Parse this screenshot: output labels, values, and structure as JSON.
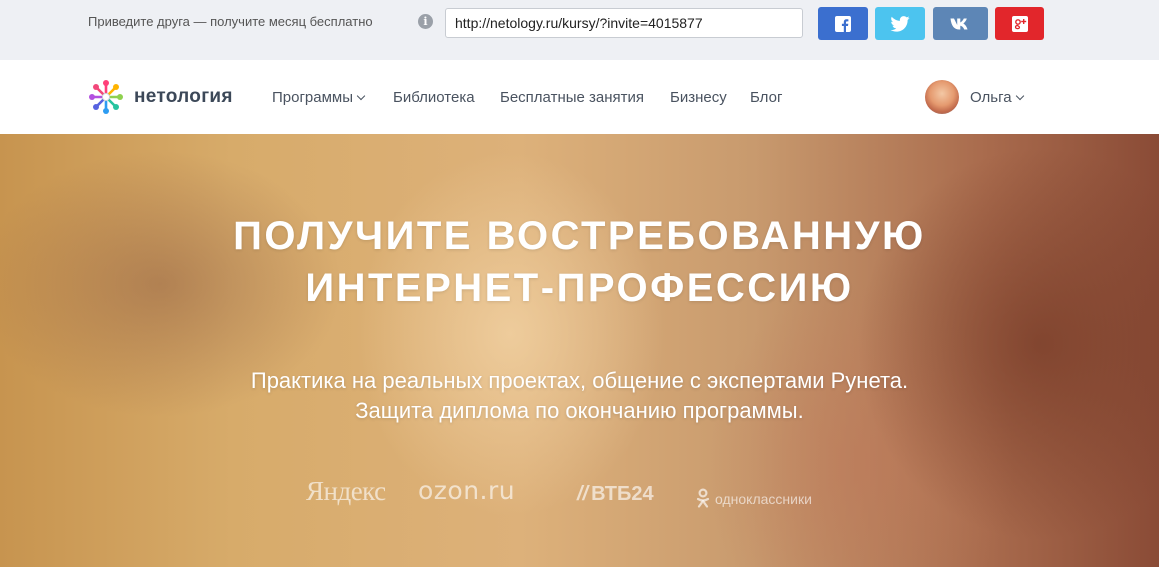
{
  "referral": {
    "text": "Приведите друга — получите месяц бесплатно",
    "info_icon": "info-icon",
    "invite_url": "http://netology.ru/kursy/?invite=4015877",
    "share_buttons": [
      {
        "name": "facebook",
        "icon": "facebook-icon",
        "color": "#3b6fcf"
      },
      {
        "name": "twitter",
        "icon": "twitter-icon",
        "color": "#4cc4ef"
      },
      {
        "name": "vkontakte",
        "icon": "vk-icon",
        "color": "#5d86b6"
      },
      {
        "name": "google-plus",
        "icon": "google-plus-icon",
        "color": "#e2262b"
      }
    ]
  },
  "nav": {
    "logo_text": "нетология",
    "links": [
      {
        "label": "Программы",
        "dropdown": true
      },
      {
        "label": "Библиотека"
      },
      {
        "label": "Бесплатные занятия"
      },
      {
        "label": "Бизнесу"
      },
      {
        "label": "Блог"
      }
    ],
    "user": {
      "name": "Ольга",
      "dropdown": true
    }
  },
  "hero": {
    "title_line1": "ПОЛУЧИТЕ ВОСТРЕБОВАННУЮ",
    "title_line2": "ИНТЕРНЕТ-ПРОФЕССИЮ",
    "subtitle_line1": "Практика на реальных проектах, общение с экспертами Рунета.",
    "subtitle_line2": "Защита диплома по окончанию программы.",
    "partners": [
      "Яндекс",
      "ozon.ru",
      "ВТБ24",
      "одноклассники"
    ]
  }
}
